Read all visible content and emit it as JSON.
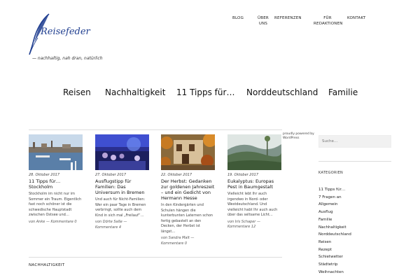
{
  "site": {
    "logo_text": "Reisefeder",
    "tagline": "— nachhaltig, nah dran, natürlich",
    "brand_color": "#1e3d8f"
  },
  "top_nav": {
    "blog": "BLOG",
    "ueber_uns": "ÜBER UNS",
    "referenzen": "REFERENZEN",
    "fuer_redaktionen": "FÜR REDAKTIONEN",
    "kontakt": "KONTAKT"
  },
  "category_nav": [
    "Reisen",
    "Nachhaltigkeit",
    "11 Tipps für…",
    "Norddeutschland",
    "Familie"
  ],
  "posts": [
    {
      "date": "28. Oktober 2017",
      "title": "11 Tipps für… Stockholm",
      "excerpt": "Stockholm im nicht nur im Sommer ein Traum. Eigentlich fast noch schöner ist die schwedische Hauptstadt zwischen Ostsee und…",
      "meta": "von Anke — Kommentare 0",
      "image": "stockholm-harbor"
    },
    {
      "date": "27. Oktober 2017",
      "title": "Ausflugstipp für Familien: Das Universum in Bremen",
      "excerpt": "Und auch für Nicht-Familien: Wer ein paar Tage in Bremen verbringt, sollte auch dem Kind in sich mal „Freilauf“…",
      "meta": "von Dörte Saße — Kommentare 4",
      "image": "universum-bremen"
    },
    {
      "date": "22. Oktober 2017",
      "title": "Der Herbst: Gedanken zur goldenen Jahreszeit – und ein Gedicht von Hermann Hesse",
      "excerpt": "In den Kindergärten und Schulen hängen die kunterbunten Laternen schon fertig gebastelt an den Decken, der Herbst ist längst…",
      "meta": "von Sandra Malt — Kommentare 0",
      "image": "autumn-house"
    },
    {
      "date": "19. Oktober 2017",
      "title": "Eukalyptus: Europas Pest in Baumgestalt",
      "excerpt": "Vielleicht lebt Ihr auch irgendwo in Nord- oder Westdeutschland. Und vielleicht habt Ihr auch auch über das seltsame Licht…",
      "meta": "von Iris Schaper — Kommentare 12",
      "image": "eucalyptus-forest"
    }
  ],
  "section_label": "NACHHALTIGKEIT",
  "sidebar": {
    "powered_by": "proudly powered by WordPress",
    "search_placeholder": "Suche…",
    "categories_heading": "KATEGORIEN",
    "categories": [
      "11 Tipps für…",
      "7 Fragen an",
      "Allgemein",
      "Ausflug",
      "Familie",
      "Nachhaltigkeit",
      "Norddeutschland",
      "Reisen",
      "Rezept",
      "Schietwetter",
      "Städtetrip",
      "Weihnachten"
    ]
  }
}
